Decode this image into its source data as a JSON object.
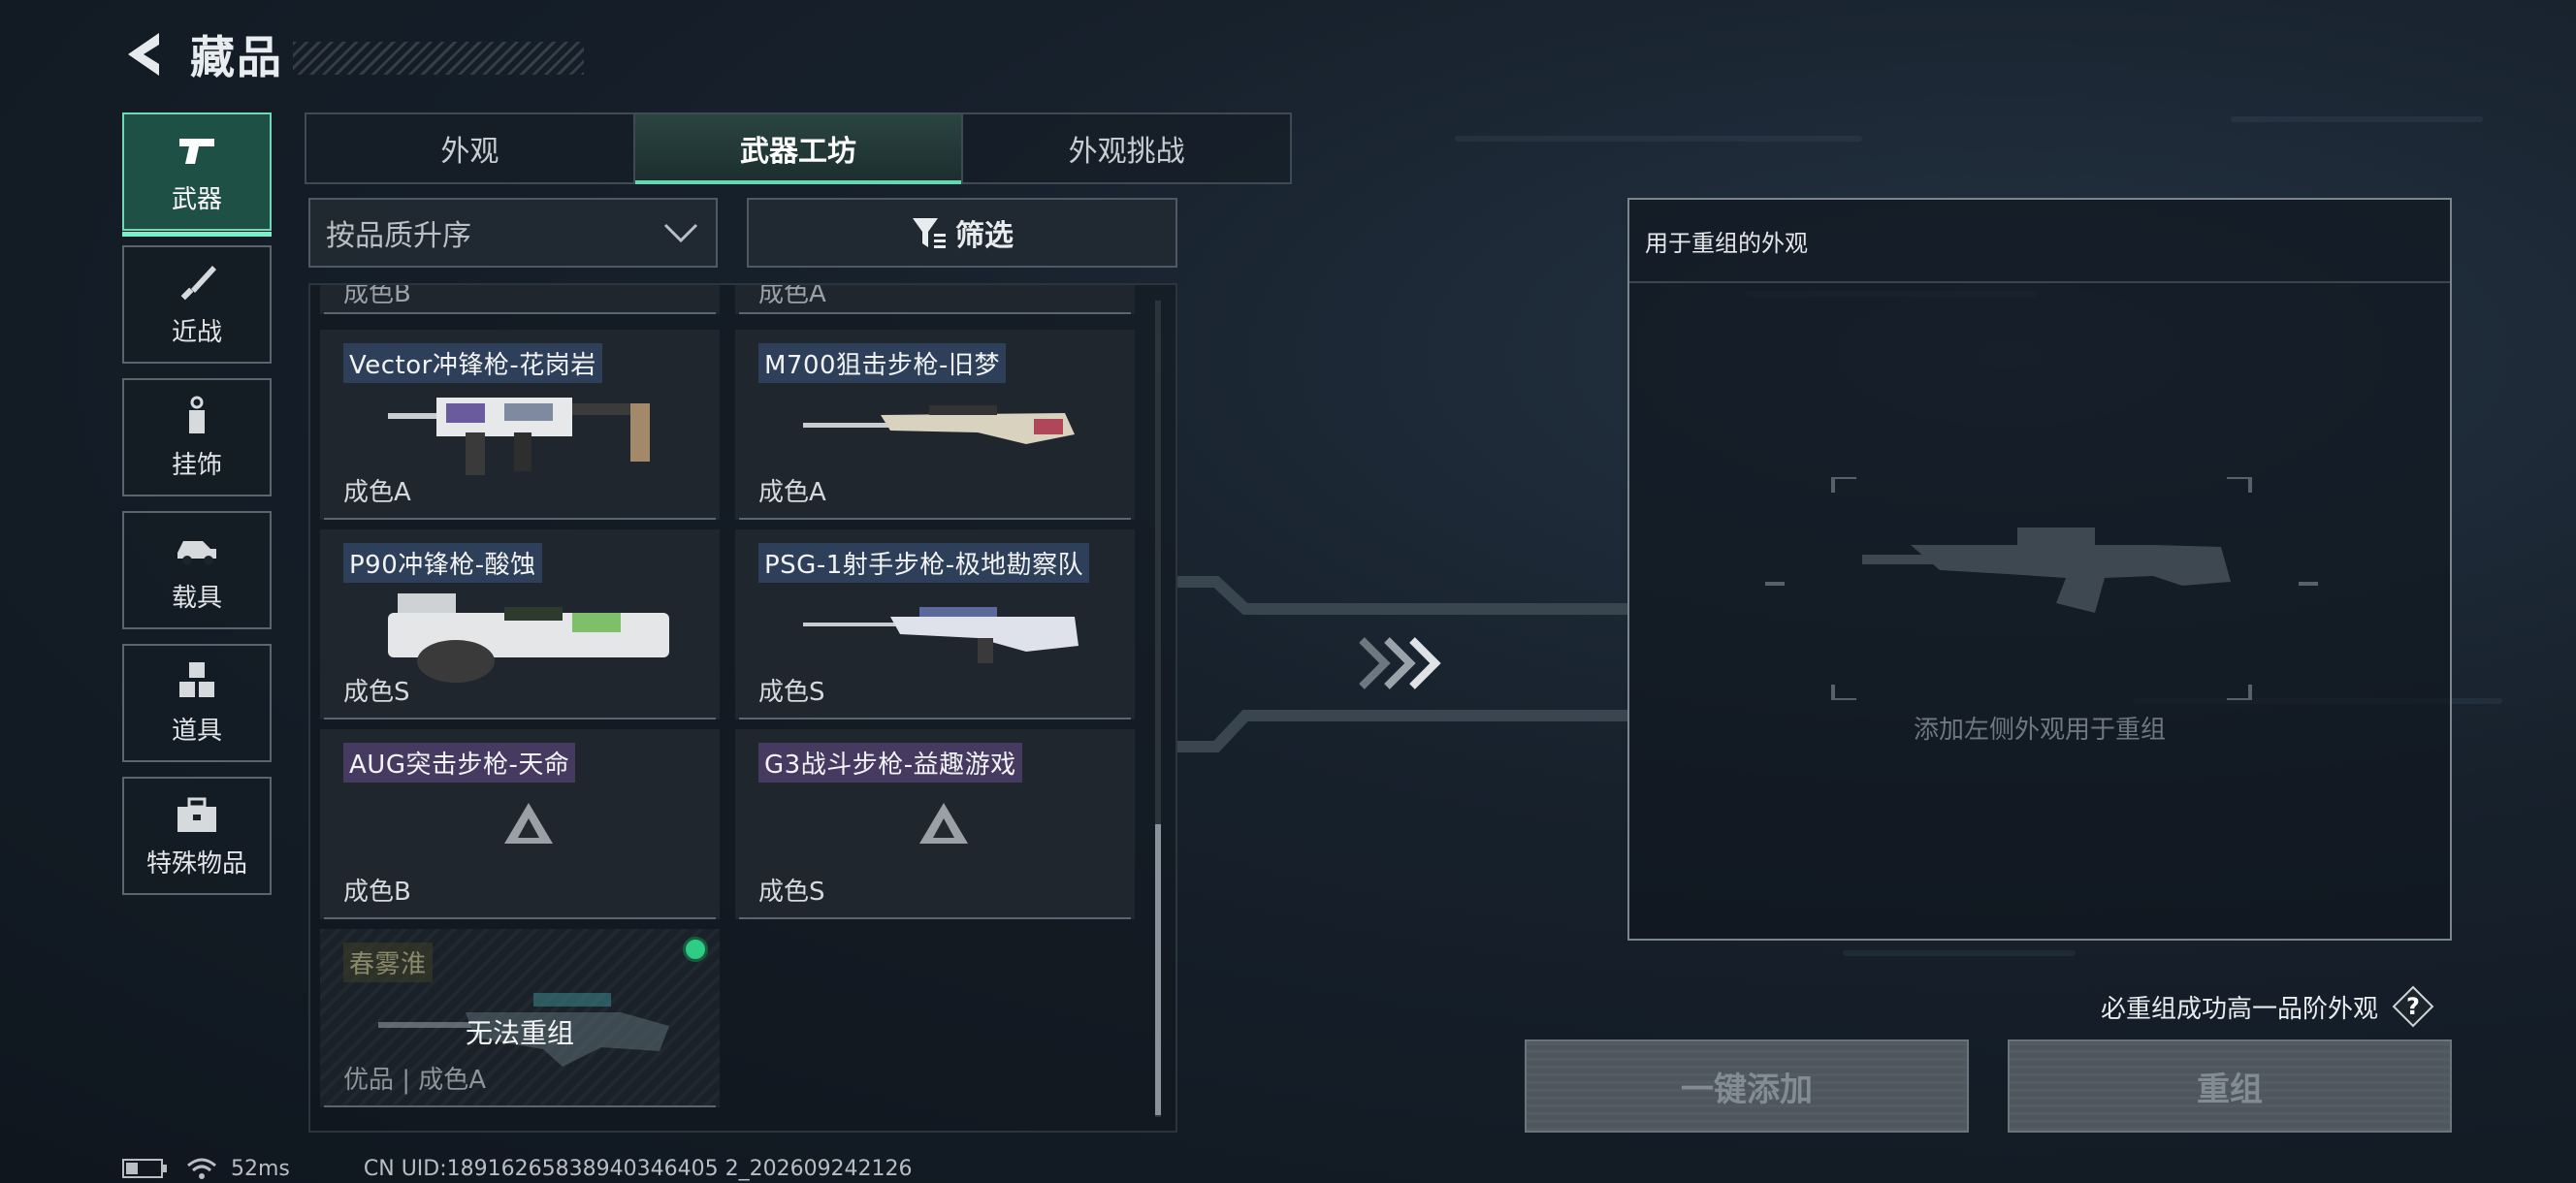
{
  "header": {
    "title": "藏品"
  },
  "categories": [
    {
      "label": "武器",
      "icon": "pistol-icon",
      "active": true
    },
    {
      "label": "近战",
      "icon": "knife-icon",
      "active": false
    },
    {
      "label": "挂饰",
      "icon": "charm-icon",
      "active": false
    },
    {
      "label": "载具",
      "icon": "vehicle-icon",
      "active": false
    },
    {
      "label": "道具",
      "icon": "cubes-icon",
      "active": false
    },
    {
      "label": "特殊物品",
      "icon": "toolbox-icon",
      "active": false
    }
  ],
  "tabs": [
    {
      "label": "外观",
      "active": false
    },
    {
      "label": "武器工坊",
      "active": true
    },
    {
      "label": "外观挑战",
      "active": false
    }
  ],
  "controls": {
    "sort_label": "按品质升序",
    "filter_label": "筛选"
  },
  "list": {
    "partial_top": [
      "成色B",
      "成色A"
    ],
    "cards": [
      {
        "name": "Vector冲锋枪-花岗岩",
        "grade": "成色A",
        "icon": "smg-vector-icon"
      },
      {
        "name": "M700狙击步枪-旧梦",
        "grade": "成色A",
        "icon": "sniper-rifle-icon"
      },
      {
        "name": "P90冲锋枪-酸蚀",
        "grade": "成色S",
        "icon": "smg-p90-icon"
      },
      {
        "name": "PSG-1射手步枪-极地勘察队",
        "grade": "成色S",
        "icon": "marksman-rifle-icon"
      },
      {
        "name": "AUG突击步枪-天命",
        "grade": "成色B",
        "icon": "triangle-icon"
      },
      {
        "name": "G3战斗步枪-益趣游戏",
        "grade": "成色S",
        "icon": "triangle-icon"
      }
    ],
    "locked_card": {
      "name": "春雾淮",
      "overlay": "无法重组",
      "grade": "优品 | 成色A",
      "icon": "assault-rifle-icon"
    }
  },
  "recombine": {
    "title": "用于重组的外观",
    "hint": "添加左侧外观用于重组",
    "rule_text": "必重组成功高一品阶外观",
    "add_button": "一键添加",
    "recombine_button": "重组"
  },
  "status": {
    "ping": "52ms",
    "uid": "CN UID:18916265838940346405 2_202609242126"
  },
  "colors": {
    "accent": "#64d9b0",
    "active_bg": "#1e5046",
    "panel_border": "#7b858e",
    "disabled_button": "#4e565e"
  }
}
